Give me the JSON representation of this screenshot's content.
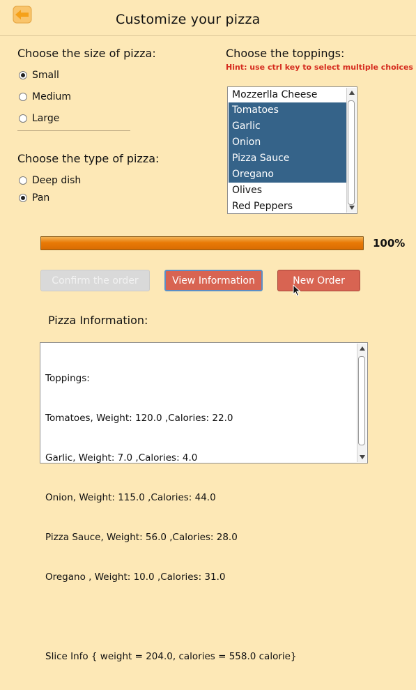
{
  "window": {
    "title": "Customize your pizza"
  },
  "size_section": {
    "heading": "Choose the size of pizza:",
    "options": [
      {
        "label": "Small",
        "selected": true
      },
      {
        "label": "Medium",
        "selected": false
      },
      {
        "label": "Large",
        "selected": false
      }
    ]
  },
  "type_section": {
    "heading": "Choose the type of pizza:",
    "options": [
      {
        "label": "Deep dish",
        "selected": false
      },
      {
        "label": "Pan",
        "selected": true
      }
    ]
  },
  "toppings_section": {
    "heading": "Choose the toppings:",
    "hint": "Hint: use ctrl key to select multiple choices",
    "items": [
      {
        "label": "Mozzerlla Cheese",
        "selected": false
      },
      {
        "label": "Tomatoes",
        "selected": true
      },
      {
        "label": "Garlic",
        "selected": true
      },
      {
        "label": "Onion",
        "selected": true
      },
      {
        "label": "Pizza Sauce",
        "selected": true
      },
      {
        "label": "Oregano",
        "selected": true
      },
      {
        "label": "Olives",
        "selected": false
      },
      {
        "label": "Red Peppers",
        "selected": false
      }
    ]
  },
  "progress": {
    "value": 1.0,
    "label": "100%"
  },
  "buttons": {
    "confirm": "Confirm the order",
    "view_info": "View Information",
    "new_order": "New Order"
  },
  "info": {
    "heading": "Pizza Information:",
    "lines": [
      "Toppings:",
      "Tomatoes, Weight: 120.0 ,Calories: 22.0",
      "Garlic, Weight: 7.0 ,Calories: 4.0",
      "Onion, Weight: 115.0 ,Calories: 44.0",
      "Pizza Sauce, Weight: 56.0 ,Calories: 28.0",
      "Oregano , Weight: 10.0 ,Calories: 31.0",
      "",
      "Slice Info { weight = 204.0, calories = 558.0 calorie}"
    ]
  },
  "colors": {
    "background": "#fde8b6",
    "selection": "#356389",
    "hint": "#d52b1e",
    "progress": "#e67c09",
    "button": "#d86452"
  },
  "icons": {
    "back": "back-arrow-icon",
    "cursor": "mouse-pointer-icon"
  }
}
